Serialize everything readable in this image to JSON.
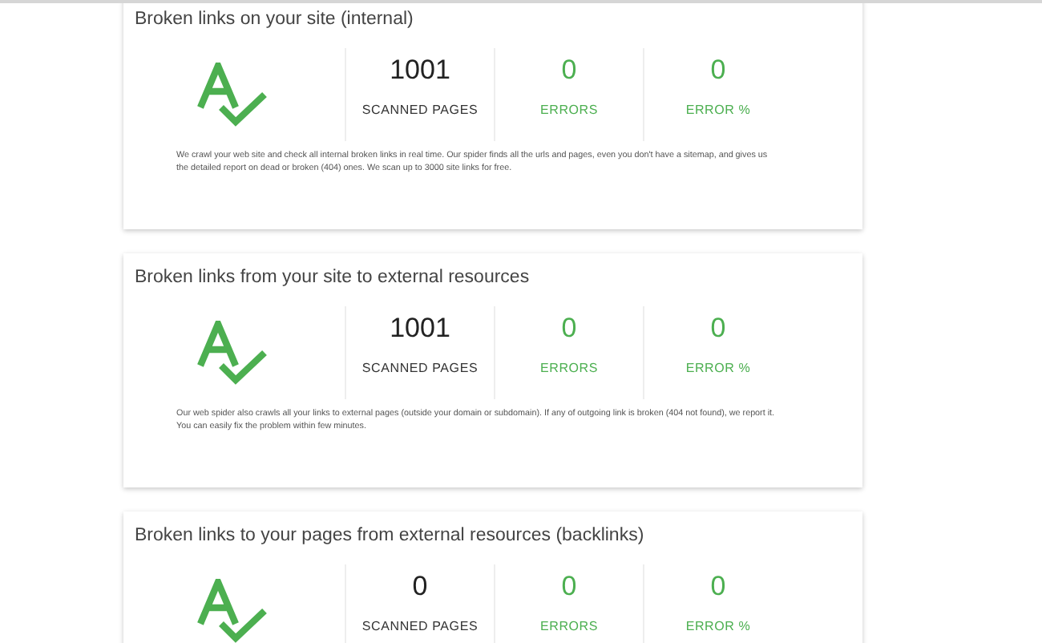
{
  "cards": [
    {
      "title": "Broken links on your site (internal)",
      "stats": [
        {
          "value": "1001",
          "label": "SCANNED PAGES",
          "kind": "count"
        },
        {
          "value": "0",
          "label": "ERRORS",
          "kind": "error"
        },
        {
          "value": "0",
          "label": "ERROR %",
          "kind": "error"
        }
      ],
      "description": "We crawl your web site and check all internal broken links in real time. Our spider finds all the urls and pages, even you don't have a sitemap, and gives us the detailed report on dead or broken (404) ones. We scan up to 3000 site links for free."
    },
    {
      "title": "Broken links from your site to external resources",
      "stats": [
        {
          "value": "1001",
          "label": "SCANNED PAGES",
          "kind": "count"
        },
        {
          "value": "0",
          "label": "ERRORS",
          "kind": "error"
        },
        {
          "value": "0",
          "label": "ERROR %",
          "kind": "error"
        }
      ],
      "description": "Our web spider also crawls all your links to external pages (outside your domain or subdomain). If any of outgoing link is broken (404 not found), we report it. You can easily fix the problem within few minutes."
    },
    {
      "title": "Broken links to your pages from external resources (backlinks)",
      "stats": [
        {
          "value": "0",
          "label": "SCANNED PAGES",
          "kind": "count"
        },
        {
          "value": "0",
          "label": "ERRORS",
          "kind": "error"
        },
        {
          "value": "0",
          "label": "ERROR %",
          "kind": "error"
        }
      ]
    }
  ]
}
